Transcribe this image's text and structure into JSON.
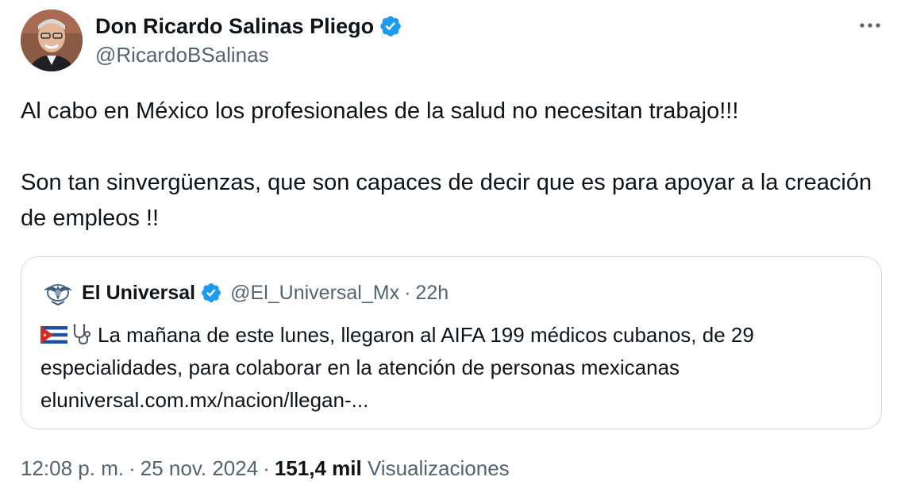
{
  "author": {
    "name": "Don Ricardo Salinas Pliego",
    "handle": "@RicardoBSalinas",
    "avatar_icon": "profile-photo-avatar",
    "verified_icon": "verified-badge-icon"
  },
  "more_icon": "more-options-icon",
  "more_label": "···",
  "tweet": {
    "paragraphs": [
      "Al cabo en México los profesionales de la salud no necesitan trabajo!!!",
      "Son tan sinvergüenzas, que son capaces de decir que es para apoyar a la creación de empleos !!"
    ]
  },
  "quote": {
    "name": "El Universal",
    "handle": "@El_Universal_Mx",
    "separator": "·",
    "time": "22h",
    "logo_icon": "el-universal-logo-icon",
    "flag_icon": "cuba-flag-icon",
    "stethoscope_icon": "stethoscope-icon",
    "text_line1": "La mañana de este lunes, llegaron al AIFA 199 médicos cubanos, de 29 especialidades, para colaborar en la atención de personas mexicanas",
    "link": "eluniversal.com.mx/nacion/llegan-..."
  },
  "footer": {
    "time": "12:08 p. m.",
    "separator": "·",
    "date": "25 nov. 2024",
    "views_count": "151,4 mil",
    "views_label": "Visualizaciones"
  },
  "colors": {
    "text_primary": "#0f1419",
    "text_secondary": "#536471",
    "verified_blue": "#1d9bf0",
    "border": "#cfd9de"
  }
}
